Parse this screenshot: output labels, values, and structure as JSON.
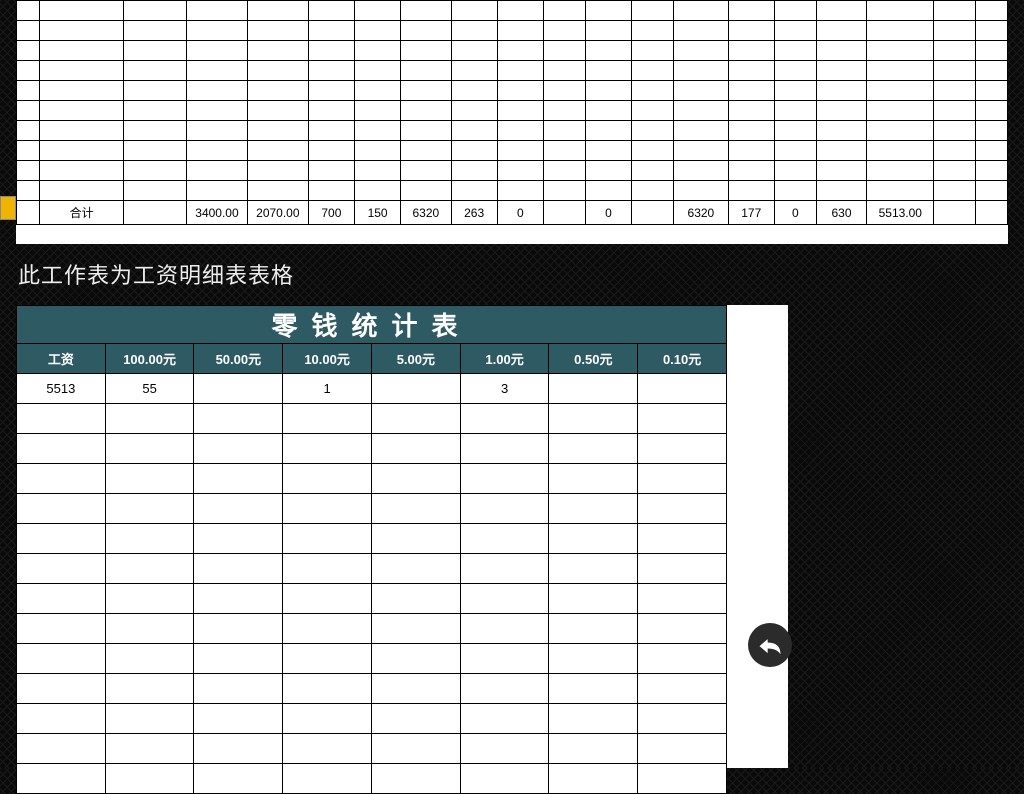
{
  "sheet1": {
    "empty_rows": 10,
    "total_label": "合计",
    "totals": [
      "",
      "",
      "",
      "3400.00",
      "2070.00",
      "700",
      "150",
      "6320",
      "263",
      "0",
      "",
      "0",
      "",
      "6320",
      "177",
      "0",
      "630",
      "5513.00",
      ""
    ]
  },
  "caption": "此工作表为工资明细表表格",
  "sheet2": {
    "title": "零钱统计表",
    "headers": [
      "工资",
      "100.00元",
      "50.00元",
      "10.00元",
      "5.00元",
      "1.00元",
      "0.50元",
      "0.10元"
    ],
    "data_row": [
      "5513",
      "55",
      "",
      "1",
      "",
      "3",
      "",
      ""
    ],
    "empty_rows": 13
  },
  "back_button_name": "back"
}
